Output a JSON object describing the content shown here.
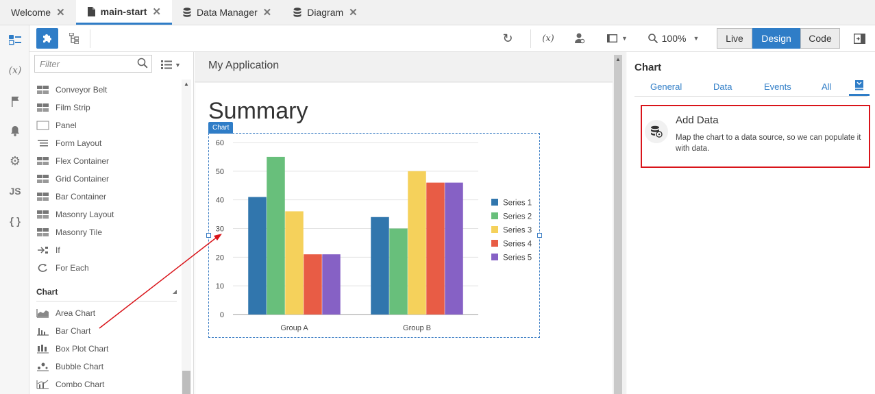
{
  "tabs": [
    {
      "label": "Welcome"
    },
    {
      "label": "main-start"
    },
    {
      "label": "Data Manager"
    },
    {
      "label": "Diagram"
    }
  ],
  "toolbar": {
    "zoom": "100%",
    "modes": [
      "Live",
      "Design",
      "Code"
    ]
  },
  "palette": {
    "filter_placeholder": "Filter",
    "layout_items": [
      "Conveyor Belt",
      "Film Strip",
      "Panel",
      "Form Layout",
      "Flex Container",
      "Grid Container",
      "Bar Container",
      "Masonry Layout",
      "Masonry Tile",
      "If",
      "For Each"
    ],
    "chart_section": "Chart",
    "chart_items": [
      "Area Chart",
      "Bar Chart",
      "Box Plot Chart",
      "Bubble Chart",
      "Combo Chart"
    ]
  },
  "canvas": {
    "app_title": "My Application",
    "page_heading": "Summary",
    "chart_badge": "Chart"
  },
  "chart_data": {
    "type": "bar",
    "categories": [
      "Group A",
      "Group B"
    ],
    "series": [
      {
        "name": "Series 1",
        "values": [
          41,
          34
        ],
        "color": "#3176ad"
      },
      {
        "name": "Series 2",
        "values": [
          55,
          30
        ],
        "color": "#68bf7b"
      },
      {
        "name": "Series 3",
        "values": [
          36,
          50
        ],
        "color": "#f5d15b"
      },
      {
        "name": "Series 4",
        "values": [
          21,
          46
        ],
        "color": "#e85c45"
      },
      {
        "name": "Series 5",
        "values": [
          21,
          46
        ],
        "color": "#8661c5"
      }
    ],
    "ylim": [
      0,
      60
    ],
    "yticks": [
      0,
      10,
      20,
      30,
      40,
      50,
      60
    ],
    "legend": "right",
    "grid": true
  },
  "properties": {
    "title": "Chart",
    "tabs": [
      "General",
      "Data",
      "Events",
      "All"
    ],
    "add_data_title": "Add Data",
    "add_data_desc": "Map the chart to a data source, so we can populate it with data."
  },
  "colors": {
    "accent": "#2f7dc7",
    "highlight": "#d9141a",
    "annotation": "#d9141a"
  }
}
